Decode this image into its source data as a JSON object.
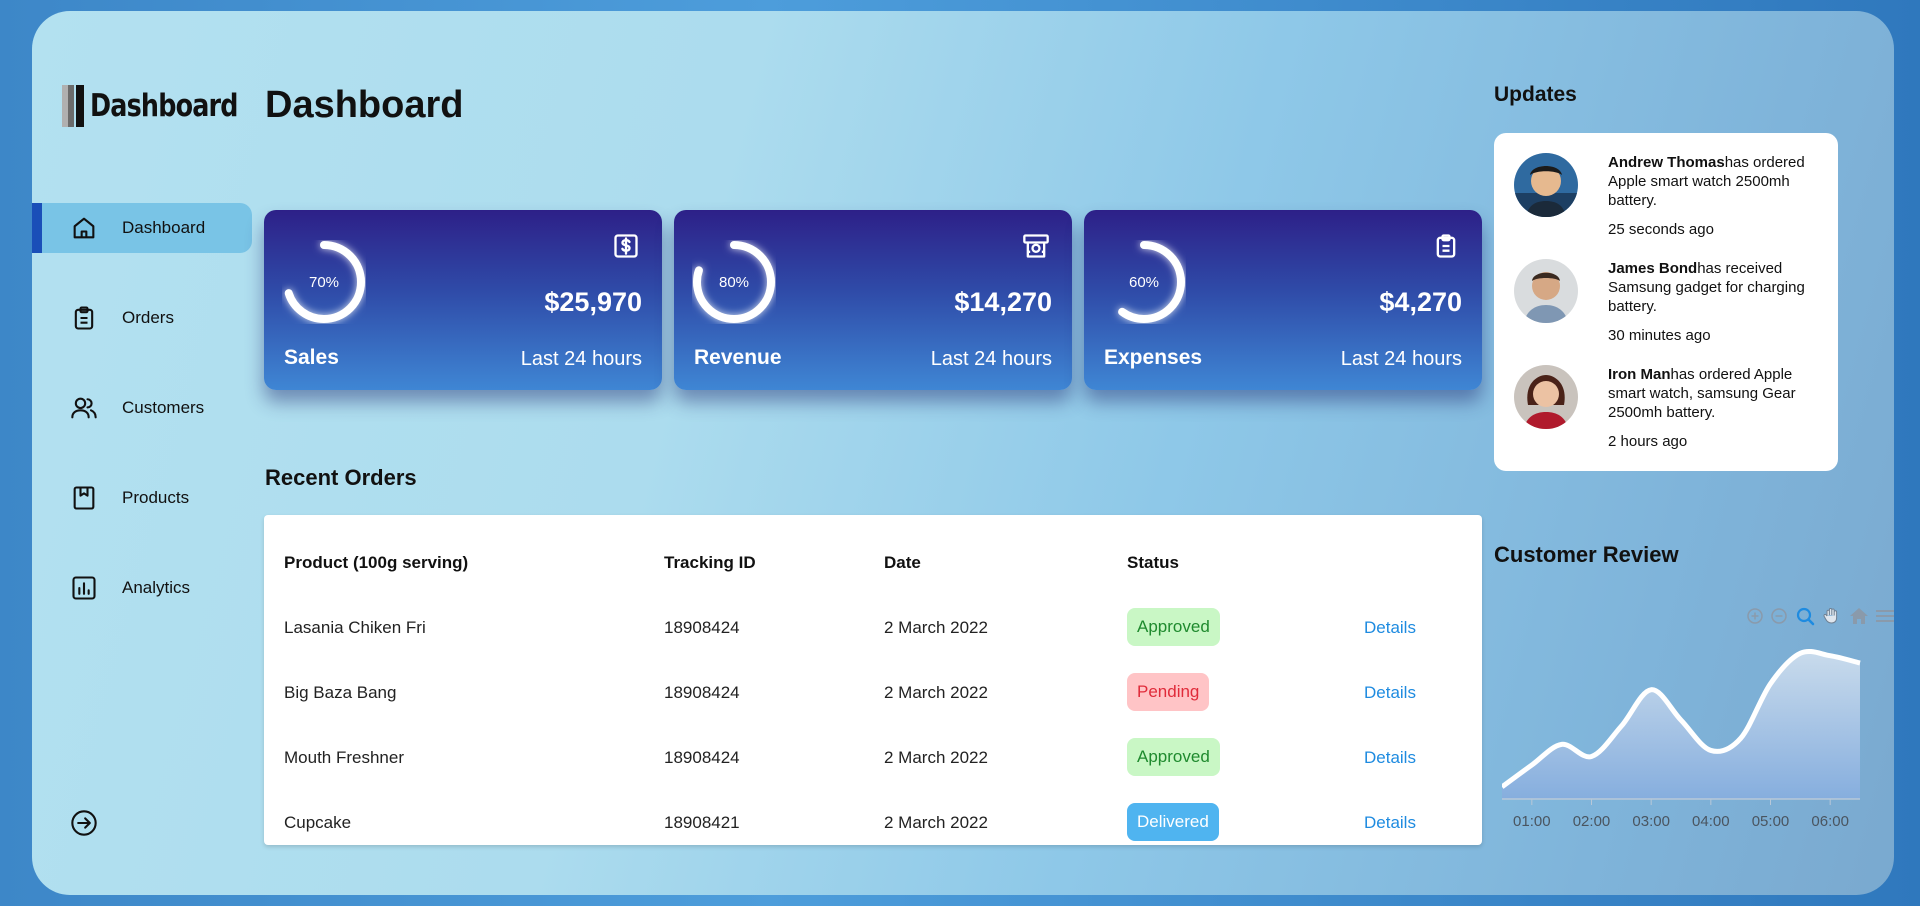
{
  "logo": {
    "text": "Dashboard"
  },
  "sidebar": {
    "items": [
      {
        "label": "Dashboard",
        "icon": "home-icon",
        "active": true
      },
      {
        "label": "Orders",
        "icon": "clipboard-icon",
        "active": false
      },
      {
        "label": "Customers",
        "icon": "users-icon",
        "active": false
      },
      {
        "label": "Products",
        "icon": "package-icon",
        "active": false
      },
      {
        "label": "Analytics",
        "icon": "bar-chart-icon",
        "active": false
      }
    ],
    "logout_icon": "logout-icon"
  },
  "main": {
    "title": "Dashboard",
    "cards": [
      {
        "title": "Sales",
        "value": "$25,970",
        "period": "Last 24 hours",
        "percent": 70,
        "percent_label": "70%",
        "icon": "dollar-icon"
      },
      {
        "title": "Revenue",
        "value": "$14,270",
        "period": "Last 24 hours",
        "percent": 80,
        "percent_label": "80%",
        "icon": "money-icon"
      },
      {
        "title": "Expenses",
        "value": "$4,270",
        "period": "Last 24 hours",
        "percent": 60,
        "percent_label": "60%",
        "icon": "clipboard-icon"
      }
    ],
    "recent_orders": {
      "title": "Recent Orders",
      "columns": [
        "Product (100g serving)",
        "Tracking ID",
        "Date",
        "Status"
      ],
      "rows": [
        {
          "product": "Lasania Chiken Fri",
          "tracking": "18908424",
          "date": "2 March 2022",
          "status": "Approved",
          "status_type": "approved",
          "action": "Details"
        },
        {
          "product": "Big Baza Bang",
          "tracking": "18908424",
          "date": "2 March 2022",
          "status": "Pending",
          "status_type": "pending",
          "action": "Details"
        },
        {
          "product": "Mouth Freshner",
          "tracking": "18908424",
          "date": "2 March 2022",
          "status": "Approved",
          "status_type": "approved",
          "action": "Details"
        },
        {
          "product": "Cupcake",
          "tracking": "18908421",
          "date": "2 March 2022",
          "status": "Delivered",
          "status_type": "delivered",
          "action": "Details"
        }
      ]
    }
  },
  "updates": {
    "title": "Updates",
    "items": [
      {
        "name": "Andrew Thomas",
        "text": "has ordered Apple smart watch 2500mh battery.",
        "time": "25 seconds ago"
      },
      {
        "name": "James Bond",
        "text": "has received Samsung gadget for charging battery.",
        "time": "30 minutes ago"
      },
      {
        "name": "Iron Man",
        "text": "has ordered Apple smart watch, samsung Gear 2500mh battery.",
        "time": "2 hours ago"
      }
    ]
  },
  "customer_review": {
    "title": "Customer Review",
    "toolbar": [
      "zoom-in-icon",
      "zoom-out-icon",
      "zoom-select-icon",
      "pan-hand-icon",
      "reset-home-icon",
      "menu-icon"
    ]
  },
  "chart_data": {
    "type": "area",
    "title": "Customer Review",
    "x": [
      "00:30",
      "01:00",
      "01:30",
      "02:00",
      "02:30",
      "03:00",
      "03:30",
      "04:00",
      "04:30",
      "05:00",
      "05:30",
      "06:00",
      "06:15"
    ],
    "x_ticks": [
      "01:00",
      "02:00",
      "03:00",
      "04:00",
      "05:00",
      "06:00"
    ],
    "series": [
      {
        "values": [
          10,
          28,
          45,
          35,
          60,
          90,
          65,
          40,
          50,
          95,
          120,
          118,
          112
        ]
      }
    ],
    "ylim": [
      0,
      140
    ],
    "grid": false,
    "colors": {
      "line": "#ffffff",
      "fill_top": "#c0d6ea",
      "fill_bottom": "#86aede"
    }
  },
  "colors": {
    "accent": "#1a4fb8",
    "card_top": "#2d2088",
    "card_bottom": "#3f86d4",
    "link": "#1e8be0"
  }
}
